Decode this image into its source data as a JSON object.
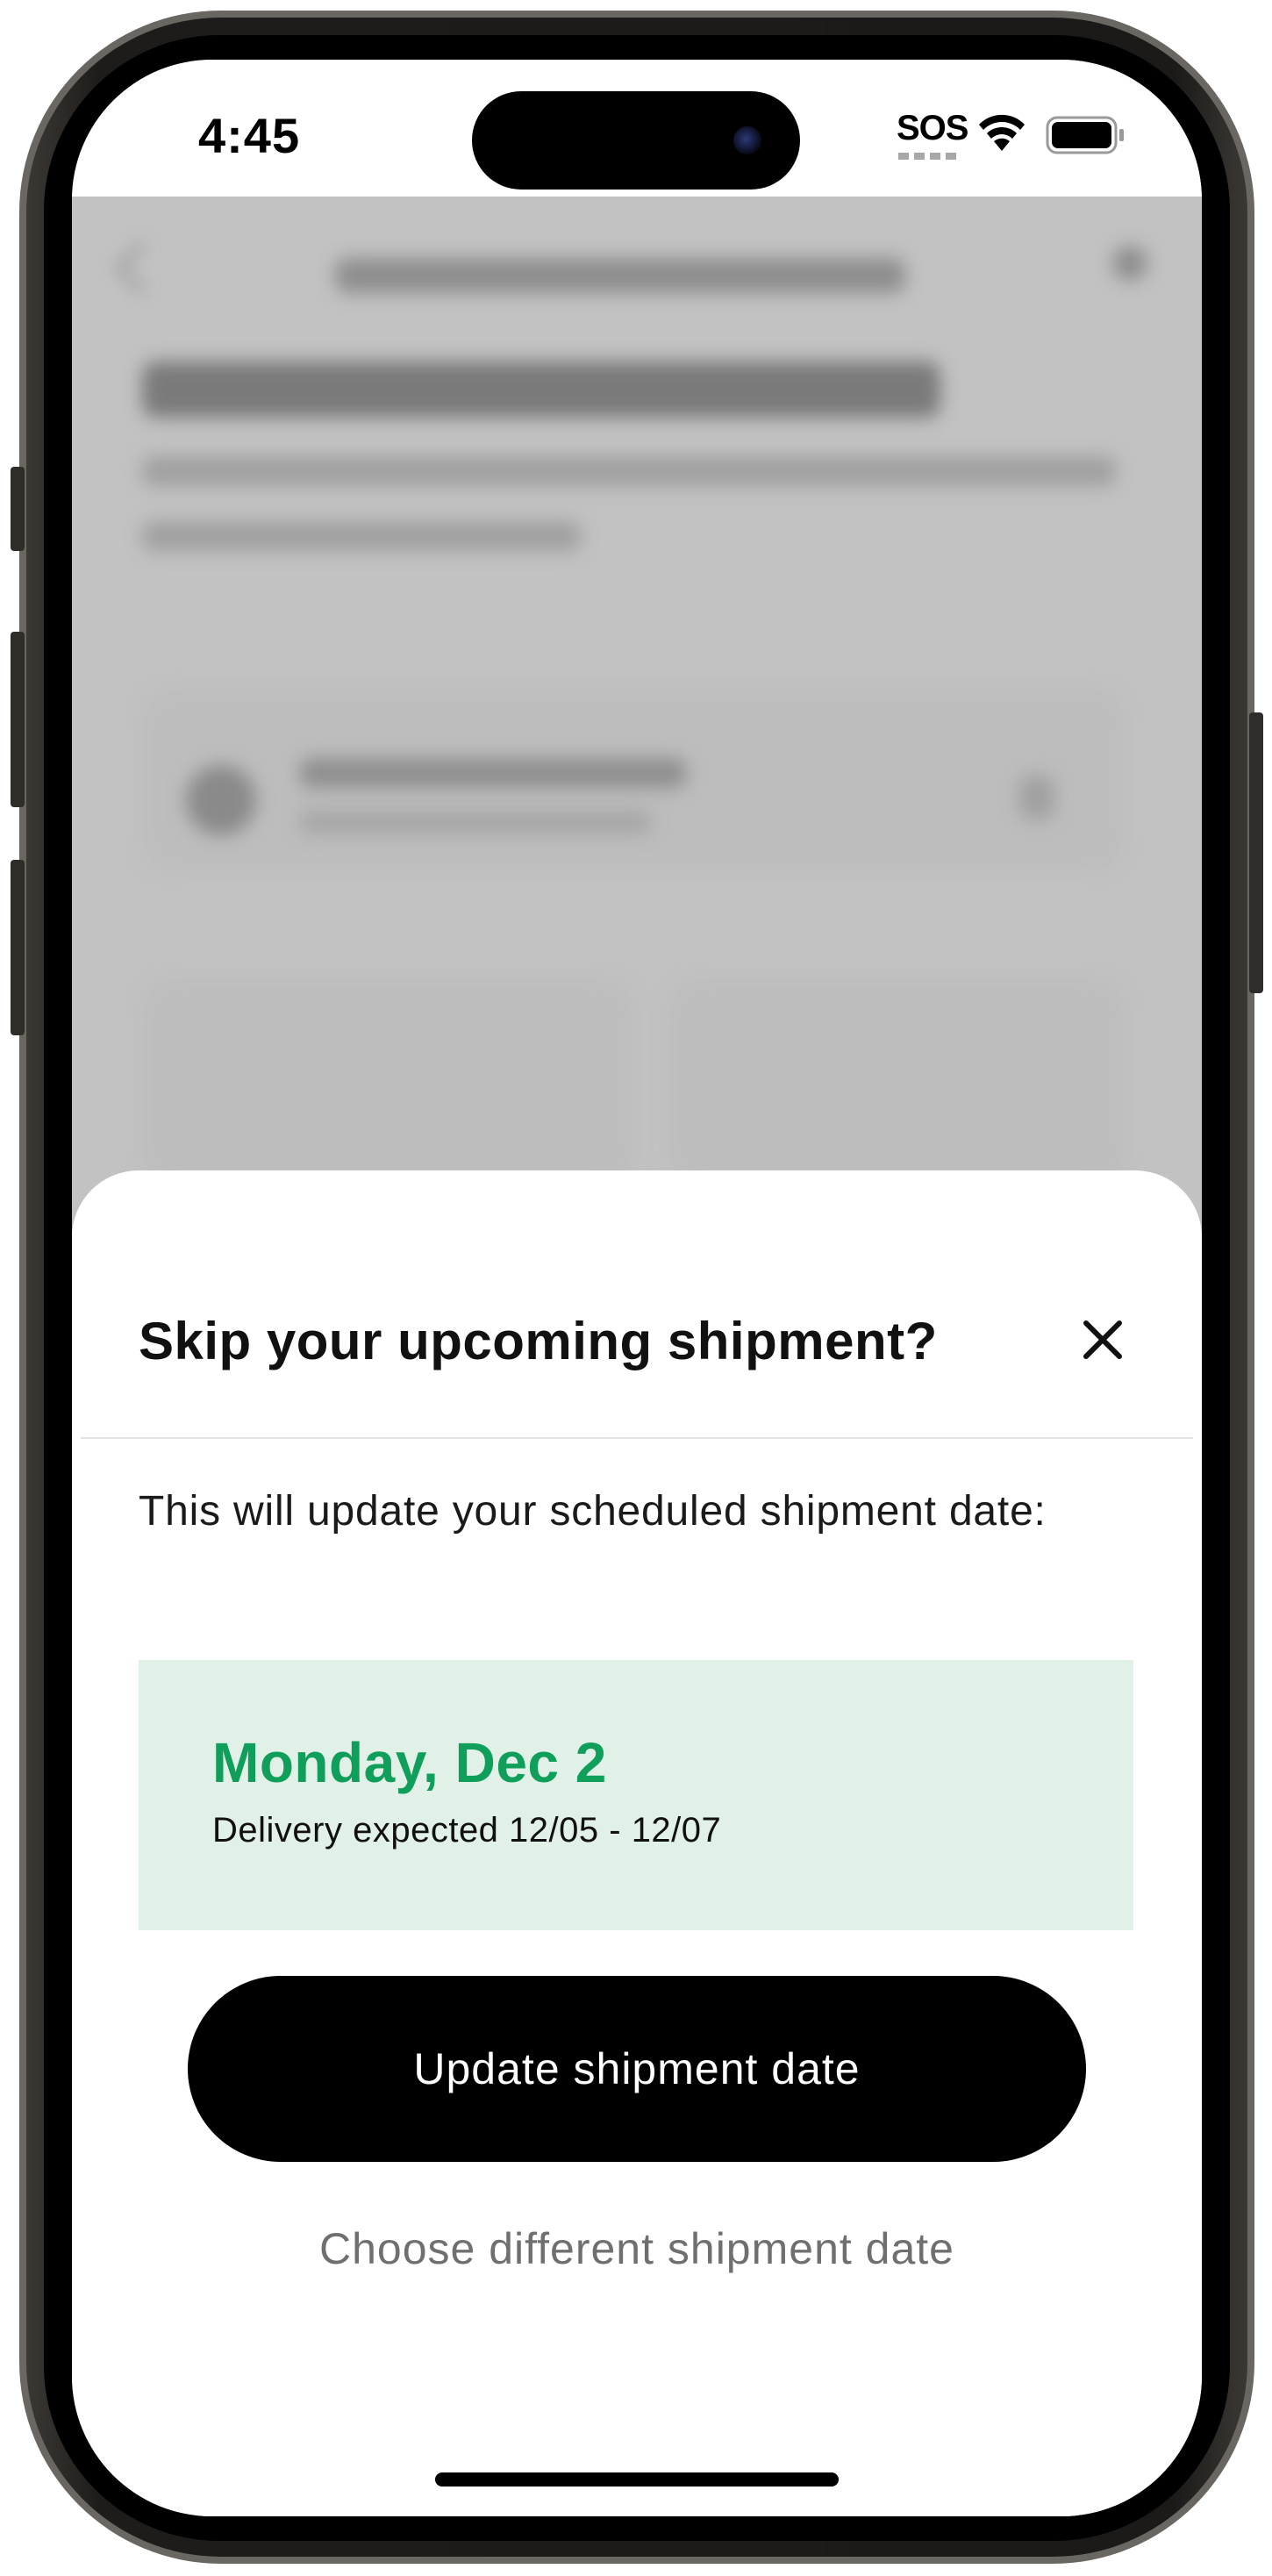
{
  "status_bar": {
    "time": "4:45",
    "sos": "SOS",
    "icons": [
      "wifi-icon",
      "battery-icon"
    ]
  },
  "sheet": {
    "title": "Skip your upcoming shipment?",
    "close_icon": "close-icon",
    "body": "This will update your scheduled shipment date:",
    "date_card": {
      "date": "Monday, Dec 2",
      "delivery": "Delivery expected 12/05 - 12/07"
    },
    "primary_button": "Update shipment date",
    "secondary_link": "Choose different shipment date"
  },
  "colors": {
    "accent_green": "#0f9f5a",
    "card_background": "#e1f1e8",
    "primary_button": "#000000",
    "backdrop": "#c2c2c2"
  }
}
